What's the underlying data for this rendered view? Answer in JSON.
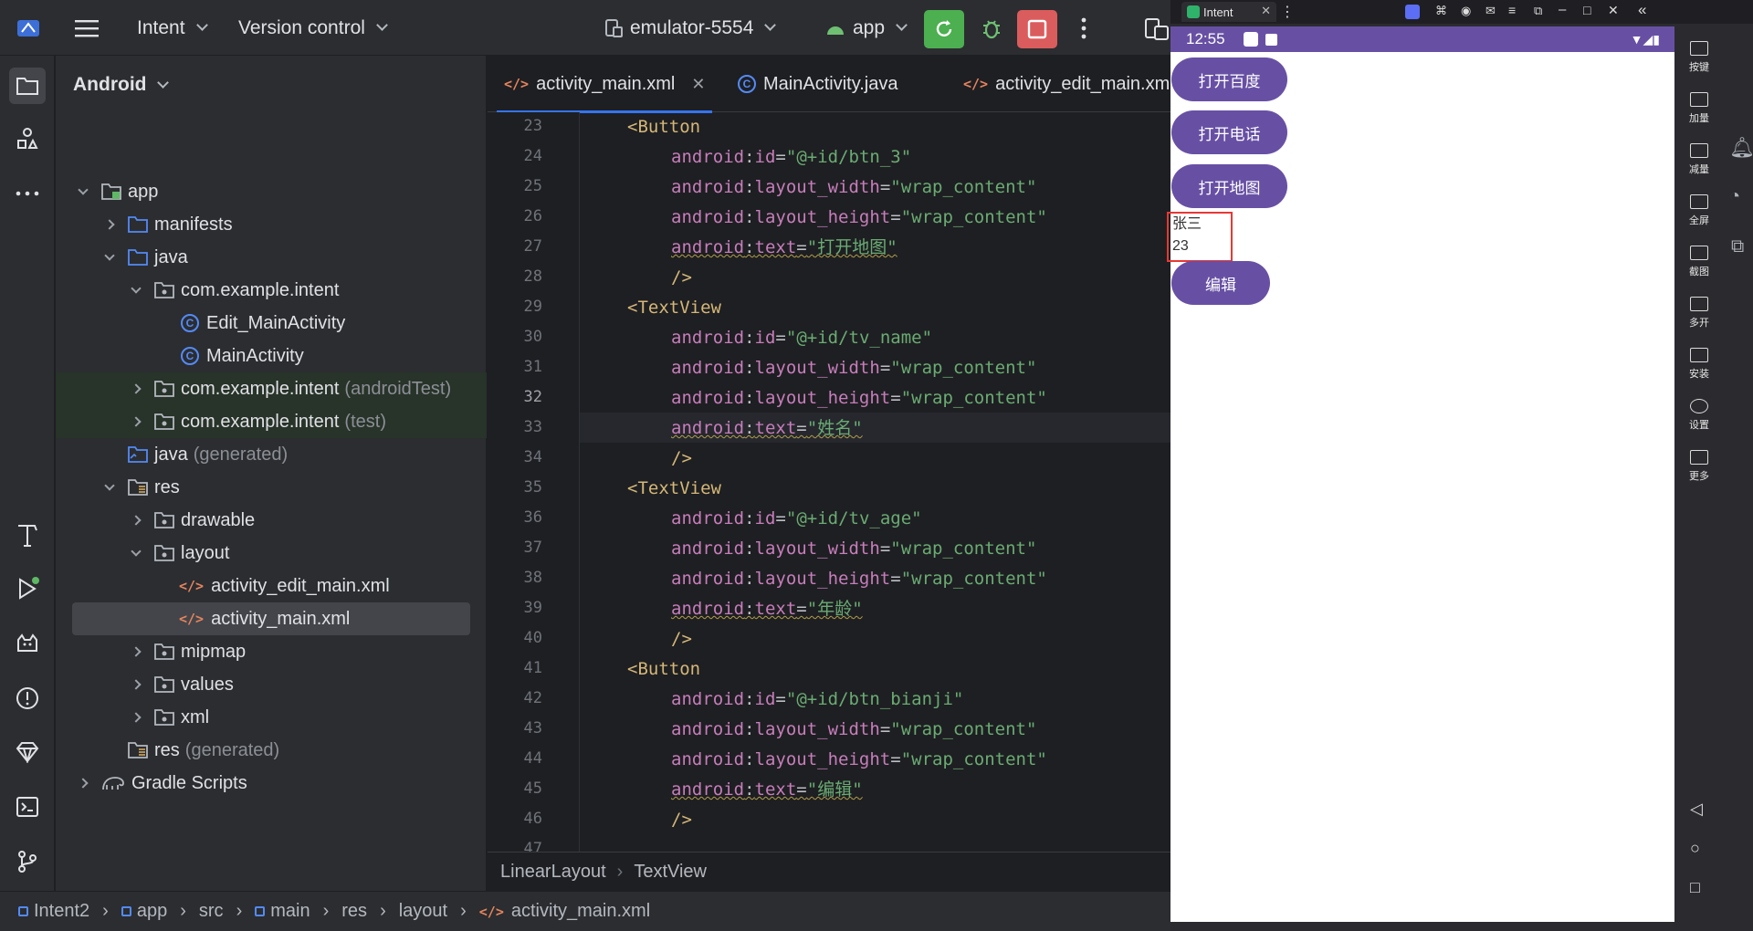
{
  "toolbar": {
    "project_name": "Intent",
    "vcs_label": "Version control",
    "device": "emulator-5554",
    "run_config": "app"
  },
  "project_panel": {
    "view_mode": "Android",
    "tree": [
      {
        "label": "app",
        "hint": ""
      },
      {
        "label": "manifests",
        "hint": ""
      },
      {
        "label": "java",
        "hint": ""
      },
      {
        "label": "com.example.intent",
        "hint": ""
      },
      {
        "label": "Edit_MainActivity",
        "hint": ""
      },
      {
        "label": "MainActivity",
        "hint": ""
      },
      {
        "label": "com.example.intent",
        "hint": "(androidTest)"
      },
      {
        "label": "com.example.intent",
        "hint": "(test)"
      },
      {
        "label": "java",
        "hint": "(generated)"
      },
      {
        "label": "res",
        "hint": ""
      },
      {
        "label": "drawable",
        "hint": ""
      },
      {
        "label": "layout",
        "hint": ""
      },
      {
        "label": "activity_edit_main.xml",
        "hint": ""
      },
      {
        "label": "activity_main.xml",
        "hint": ""
      },
      {
        "label": "mipmap",
        "hint": ""
      },
      {
        "label": "values",
        "hint": ""
      },
      {
        "label": "xml",
        "hint": ""
      },
      {
        "label": "res",
        "hint": "(generated)"
      },
      {
        "label": "Gradle Scripts",
        "hint": ""
      }
    ]
  },
  "editor": {
    "tabs": [
      {
        "label": "activity_main.xml"
      },
      {
        "label": "MainActivity.java"
      },
      {
        "label": "activity_edit_main.xm"
      }
    ],
    "line_numbers": [
      "23",
      "24",
      "25",
      "26",
      "27",
      "28",
      "29",
      "30",
      "31",
      "32",
      "33",
      "34",
      "35",
      "36",
      "37",
      "38",
      "39",
      "40",
      "41",
      "42",
      "43",
      "44",
      "45",
      "46",
      "47"
    ],
    "code": {
      "l23": "<Button",
      "l24_val": "\"@+id/btn_3\"",
      "l25_val": "\"wrap_content\"",
      "l26_val": "\"wrap_content\"",
      "l27_val": "\"打开地图\"",
      "close": "/>",
      "l29": "<TextView",
      "l30_val": "\"@+id/tv_name\"",
      "l31_val": "\"wrap_content\"",
      "l32_val": "\"wrap_content\"",
      "l33_val": "\"姓名\"",
      "l35": "<TextView",
      "l36_val": "\"@+id/tv_age\"",
      "l37_val": "\"wrap_content\"",
      "l38_val": "\"wrap_content\"",
      "l39_val": "\"年龄\"",
      "l41": "<Button",
      "l42_val": "\"@+id/btn_bianji\"",
      "l43_val": "\"wrap_content\"",
      "l44_val": "\"wrap_content\"",
      "l45_val": "\"编辑\"",
      "ns": "android",
      "attr_id": "id",
      "attr_w": "layout_width",
      "attr_h": "layout_height",
      "attr_text": "text",
      "colon": ":",
      "eq": "="
    },
    "breadcrumb": [
      "LinearLayout",
      "TextView"
    ]
  },
  "statusbar": {
    "path": [
      "Intent2",
      "app",
      "src",
      "main",
      "res",
      "layout",
      "activity_main.xml"
    ]
  },
  "emulator": {
    "window_tab": "Intent",
    "time": "12:55",
    "buttons": [
      "打开百度",
      "打开电话",
      "打开地图"
    ],
    "name_text": "张三",
    "age_text": "23",
    "edit_button": "编辑",
    "side_labels": [
      "按键",
      "加量",
      "减量",
      "全屏",
      "截图",
      "多开",
      "安装",
      "设置",
      "更多"
    ]
  },
  "colors": {
    "accent": "#3574f0",
    "run_green": "#4caf50",
    "stop_red": "#db5c5c",
    "phone_primary": "#6750a4"
  }
}
